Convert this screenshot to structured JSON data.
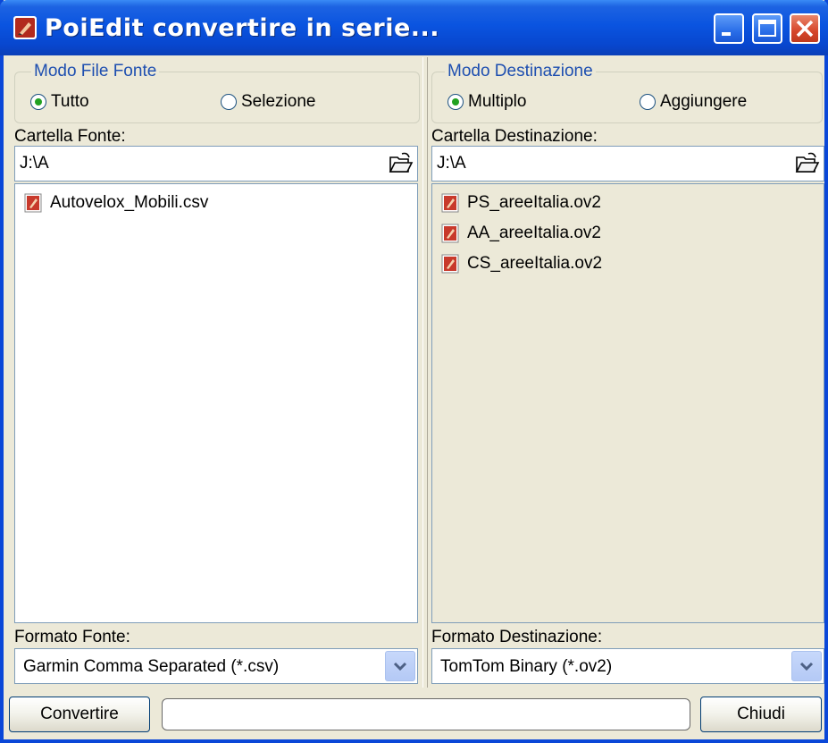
{
  "window": {
    "title": "PoiEdit convertire in serie...",
    "accent": "#0a54e0",
    "close_color": "#d6462a"
  },
  "source": {
    "mode_legend": "Modo File Fonte",
    "mode_options": [
      {
        "label": "Tutto",
        "checked": true
      },
      {
        "label": "Selezione",
        "checked": false
      }
    ],
    "folder_label": "Cartella Fonte:",
    "folder_path": "J:\\A",
    "files": [
      "Autovelox_Mobili.csv"
    ],
    "format_label": "Formato Fonte:",
    "format_value": "Garmin Comma Separated (*.csv)"
  },
  "destination": {
    "mode_legend": "Modo Destinazione",
    "mode_options": [
      {
        "label": "Multiplo",
        "checked": true
      },
      {
        "label": "Aggiungere",
        "checked": false
      }
    ],
    "folder_label": "Cartella Destinazione:",
    "folder_path": "J:\\A",
    "files": [
      "PS_areeItalia.ov2",
      "AA_areeItalia.ov2",
      "CS_areeItalia.ov2"
    ],
    "format_label": "Formato Destinazione:",
    "format_value": "TomTom Binary (*.ov2)"
  },
  "footer": {
    "convert_label": "Convertire",
    "close_label": "Chiudi",
    "progress": 0
  },
  "icons": {
    "app": "poiedit-app-icon",
    "folder": "open-folder-icon",
    "file": "poi-file-icon",
    "dropdown": "chevron-down-icon"
  }
}
